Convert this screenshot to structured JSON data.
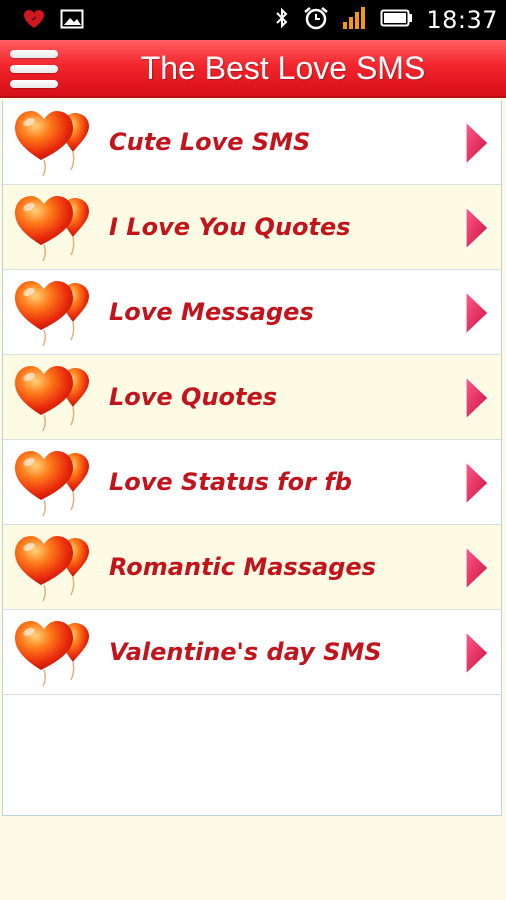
{
  "status_bar": {
    "time": "18:37",
    "icons": [
      "notification-heart-icon",
      "gallery-icon",
      "bluetooth-icon",
      "alarm-icon",
      "signal-icon",
      "battery-icon"
    ]
  },
  "app_bar": {
    "title": "The Best Love SMS",
    "menu_icon": "hamburger-menu-icon"
  },
  "colors": {
    "accent": "#e81d25",
    "item_text": "#c2141c",
    "alt_row": "#fdfbe3",
    "arrow": "#e6215a"
  },
  "items": [
    {
      "label": "Cute Love SMS"
    },
    {
      "label": "I Love You Quotes"
    },
    {
      "label": "Love Messages"
    },
    {
      "label": "Love Quotes"
    },
    {
      "label": "Love Status for fb"
    },
    {
      "label": "Romantic Massages"
    },
    {
      "label": "Valentine's day SMS"
    }
  ]
}
